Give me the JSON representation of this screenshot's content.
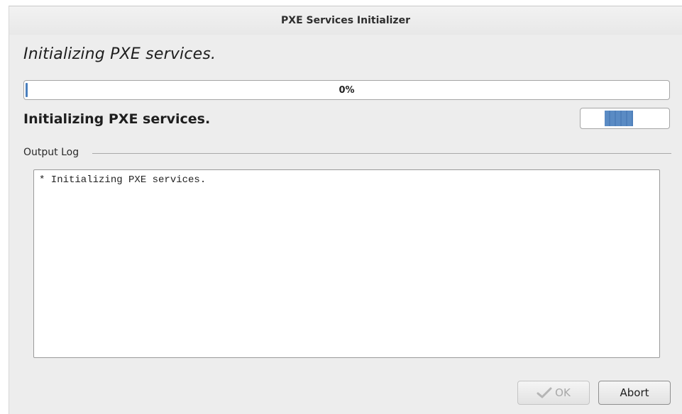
{
  "window": {
    "title": "PXE Services Initializer"
  },
  "heading": "Initializing PXE services.",
  "progress": {
    "value": 0,
    "label": "0%"
  },
  "status": "Initializing PXE services.",
  "output": {
    "legend": "Output Log",
    "log": "* Initializing PXE services."
  },
  "buttons": {
    "ok": "OK",
    "abort": "Abort"
  },
  "icons": {
    "ok": "check-icon"
  },
  "colors": {
    "accent": "#4a7fbd",
    "background": "#ededed"
  }
}
